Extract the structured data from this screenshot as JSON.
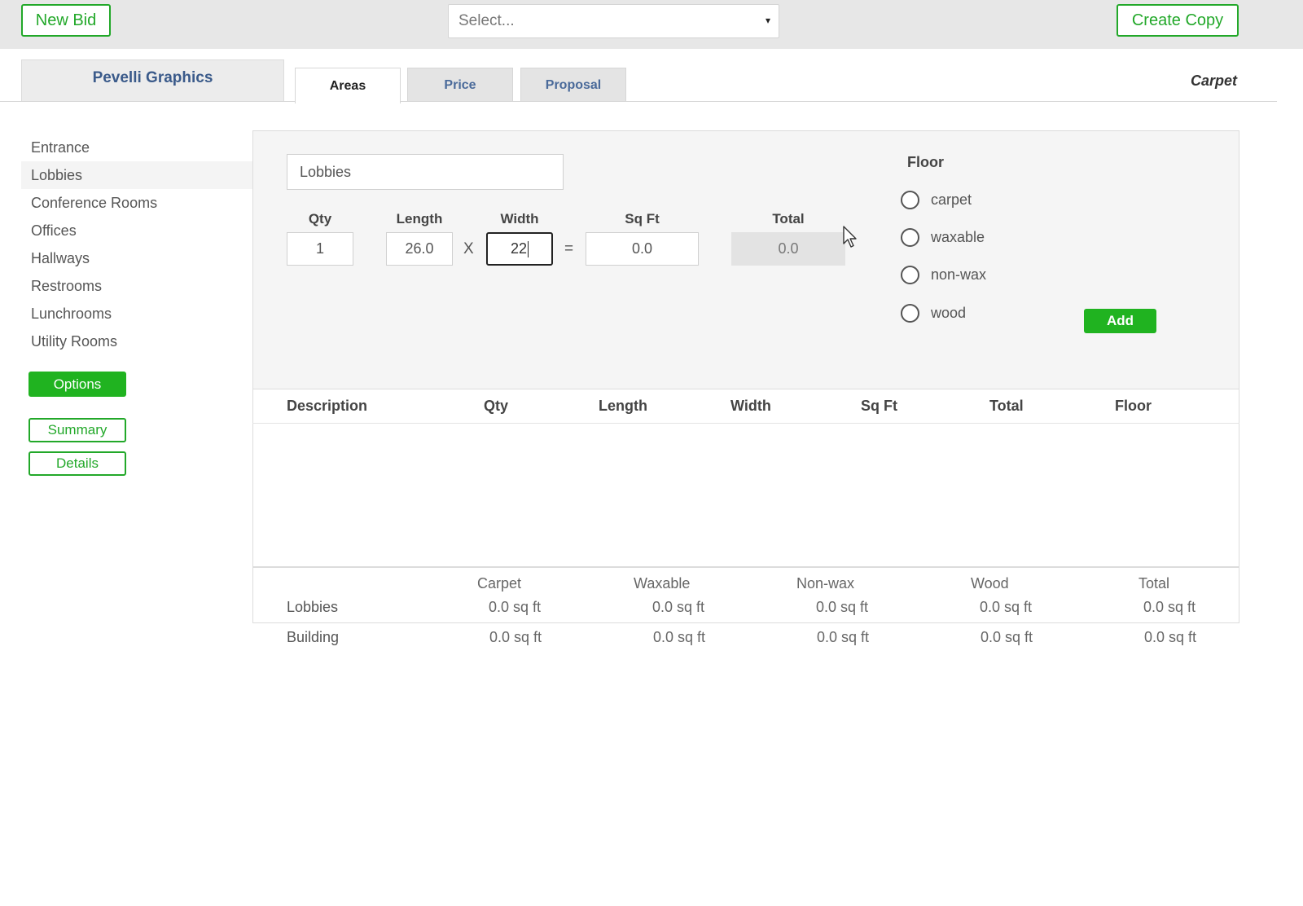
{
  "toolbar": {
    "new_bid_label": "New Bid",
    "select_placeholder": "Select...",
    "select_caret": "▾",
    "create_copy_label": "Create Copy"
  },
  "header": {
    "company": "Pevelli Graphics",
    "tabs": [
      {
        "label": "Areas",
        "active": true
      },
      {
        "label": "Price",
        "active": false
      },
      {
        "label": "Proposal",
        "active": false
      }
    ],
    "floor_type": "Carpet"
  },
  "sidebar": {
    "items": [
      {
        "label": "Entrance",
        "active": false
      },
      {
        "label": "Lobbies",
        "active": true
      },
      {
        "label": "Conference Rooms",
        "active": false
      },
      {
        "label": "Offices",
        "active": false
      },
      {
        "label": "Hallways",
        "active": false
      },
      {
        "label": "Restrooms",
        "active": false
      },
      {
        "label": "Lunchrooms",
        "active": false
      },
      {
        "label": "Utility Rooms",
        "active": false
      }
    ],
    "options_label": "Options",
    "summary_label": "Summary",
    "details_label": "Details"
  },
  "form": {
    "area_name": "Lobbies",
    "labels": {
      "qty": "Qty",
      "length": "Length",
      "width": "Width",
      "sqft": "Sq Ft",
      "total": "Total"
    },
    "values": {
      "qty": "1",
      "length": "26.0",
      "width": "22",
      "sqft": "0.0",
      "total": "0.0"
    },
    "times_sign": "X",
    "equals_sign": "=",
    "floor_title": "Floor",
    "floor_options": [
      "carpet",
      "waxable",
      "non-wax",
      "wood"
    ],
    "add_label": "Add"
  },
  "table": {
    "columns": [
      "Description",
      "Qty",
      "Length",
      "Width",
      "Sq Ft",
      "Total",
      "Floor"
    ],
    "rows": []
  },
  "summary": {
    "columns": [
      "Carpet",
      "Waxable",
      "Non-wax",
      "Wood",
      "Total"
    ],
    "rows": [
      {
        "label": "Lobbies",
        "values": [
          "0.0 sq ft",
          "0.0 sq ft",
          "0.0 sq ft",
          "0.0 sq ft",
          "0.0 sq ft"
        ]
      },
      {
        "label": "Building",
        "values": [
          "0.0 sq ft",
          "0.0 sq ft",
          "0.0 sq ft",
          "0.0 sq ft",
          "0.0 sq ft"
        ]
      }
    ]
  },
  "colors": {
    "accent_green": "#20b320",
    "link_blue": "#3a5a8a"
  }
}
